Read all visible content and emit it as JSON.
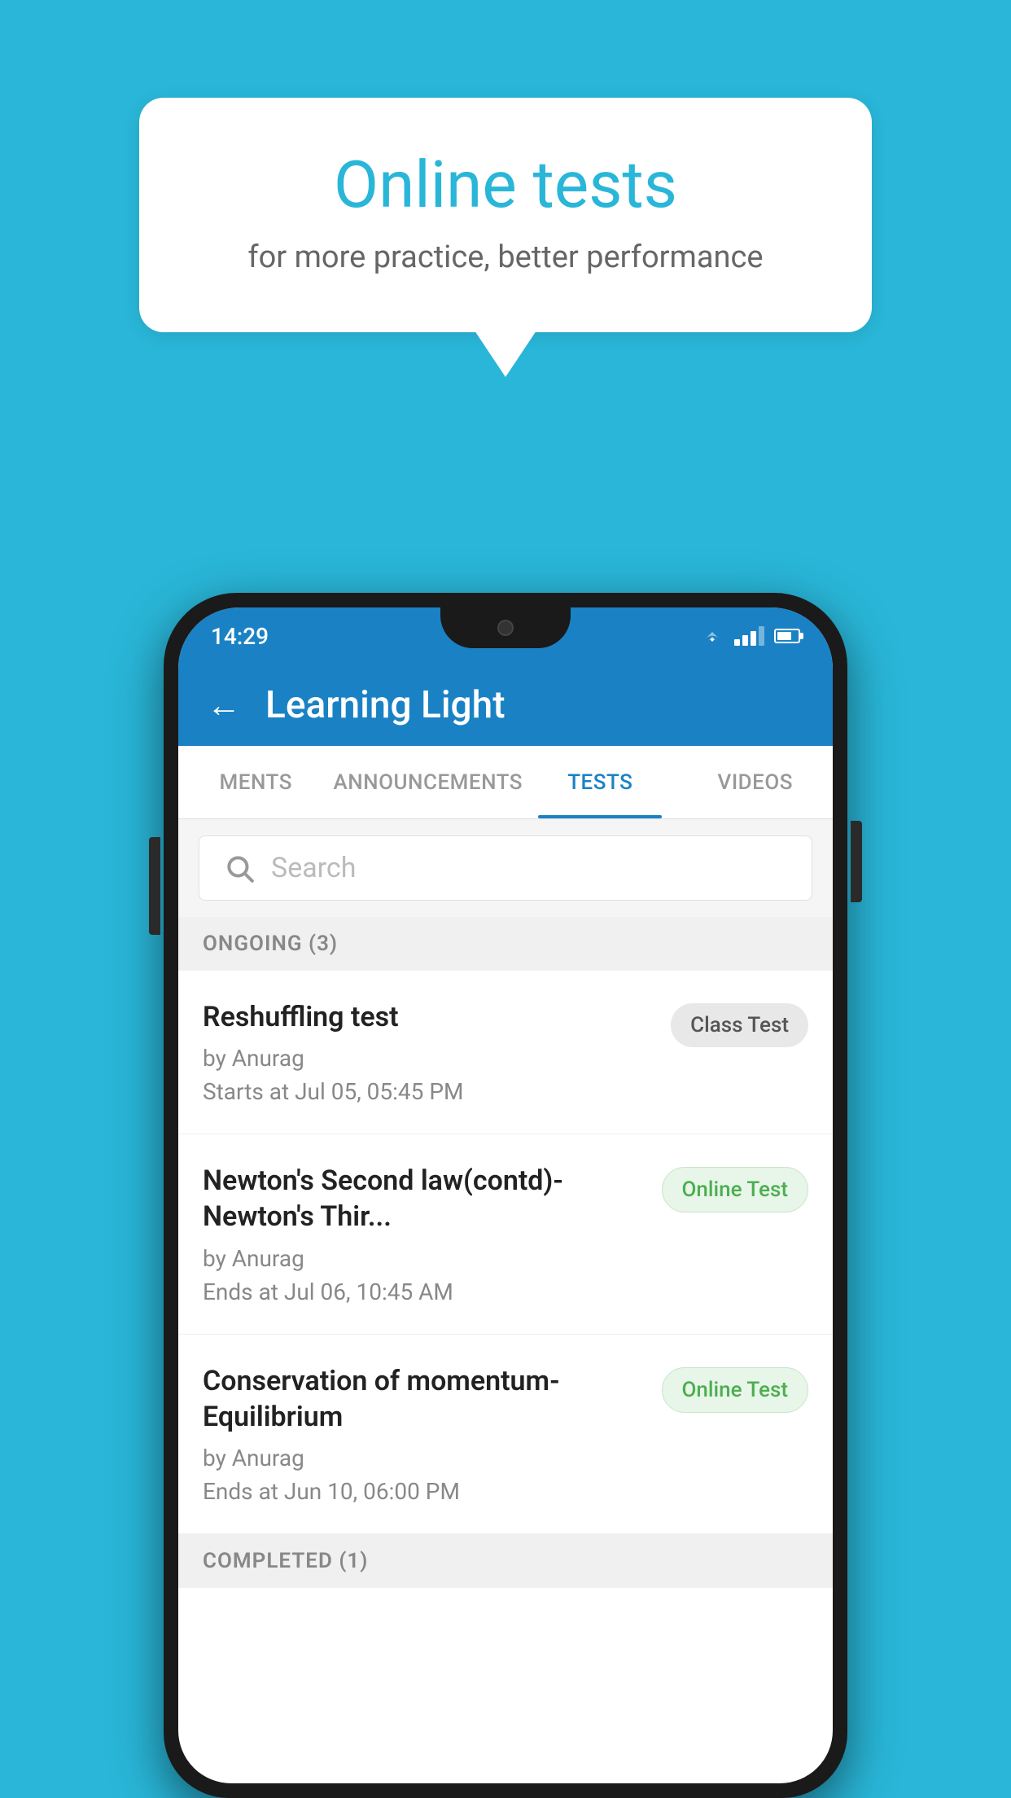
{
  "background_color": "#29B6D8",
  "speech_bubble": {
    "title": "Online tests",
    "subtitle": "for more practice, better performance"
  },
  "status_bar": {
    "time": "14:29"
  },
  "app_header": {
    "title": "Learning Light",
    "back_label": "←"
  },
  "tabs": [
    {
      "label": "MENTS",
      "active": false
    },
    {
      "label": "ANNOUNCEMENTS",
      "active": false
    },
    {
      "label": "TESTS",
      "active": true
    },
    {
      "label": "VIDEOS",
      "active": false
    }
  ],
  "search": {
    "placeholder": "Search"
  },
  "ongoing_section": {
    "title": "ONGOING (3)"
  },
  "tests": [
    {
      "name": "Reshuffling test",
      "author": "by Anurag",
      "date": "Starts at  Jul 05, 05:45 PM",
      "badge": "Class Test",
      "badge_type": "class"
    },
    {
      "name": "Newton's Second law(contd)-Newton's Thir...",
      "author": "by Anurag",
      "date": "Ends at  Jul 06, 10:45 AM",
      "badge": "Online Test",
      "badge_type": "online"
    },
    {
      "name": "Conservation of momentum-Equilibrium",
      "author": "by Anurag",
      "date": "Ends at  Jun 10, 06:00 PM",
      "badge": "Online Test",
      "badge_type": "online"
    }
  ],
  "completed_section": {
    "title": "COMPLETED (1)"
  }
}
